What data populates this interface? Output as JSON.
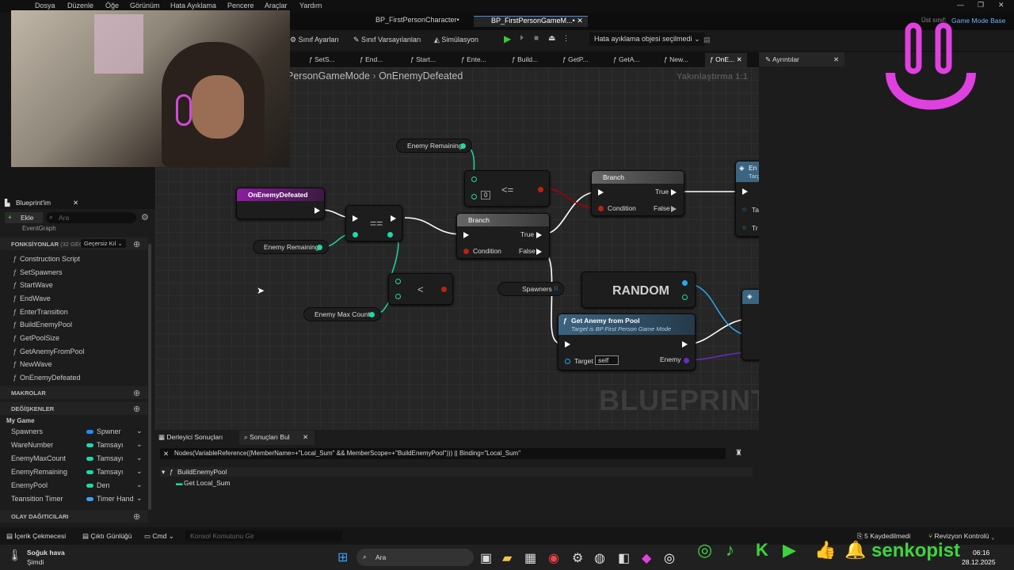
{
  "menu": {
    "items": [
      "Dosya",
      "Düzenle",
      "Öğe",
      "Görünüm",
      "Hata Ayıklama",
      "Pencere",
      "Araçlar",
      "Yardım"
    ]
  },
  "doc_tabs": {
    "tab1": "BP_FirstPersonCharacter•",
    "tab2": "BP_FirstPersonGameM...•",
    "parent_label": "Üst sınıf:",
    "parent_value": "Game Mode Base"
  },
  "toolbar": {
    "class_settings": "Sınıf Ayarları",
    "class_defaults": "Sınıf Varsayılanları",
    "simulation": "Simülasyon",
    "debug_select": "Hata ayıklama objesi seçilmedi"
  },
  "func_tabs": [
    "SetS...",
    "End...",
    "Start...",
    "Ente...",
    "Build...",
    "GetP...",
    "GetA...",
    "New...",
    "OnE..."
  ],
  "details": {
    "title": "Ayrıntılar"
  },
  "breadcrumb": {
    "path": "PersonGameMode",
    "current": "OnEnemyDefeated",
    "zoom": "Yakınlaştırma 1:1"
  },
  "graph": {
    "event_node": "OnEnemyDefeated",
    "enemy_remaining_1": "Enemy Remaining",
    "enemy_remaining_2": "Enemy Remaining",
    "enemy_max_count": "Enemy Max Count",
    "equals_op": "==",
    "lte_op": "<=",
    "lt_op": "<",
    "lte_value": "0",
    "branch1_title": "Branch",
    "branch1_true": "True",
    "branch1_false": "False",
    "branch1_cond": "Condition",
    "branch2_title": "Branch",
    "branch2_true": "True",
    "branch2_false": "False",
    "branch2_cond": "Condition",
    "spawners": "Spawners",
    "random": "RANDOM",
    "getpool_title": "Get Anemy from Pool",
    "getpool_sub": "Target is BP First Person Game Mode",
    "getpool_target": "Target",
    "getpool_self": "self",
    "getpool_enemy": "Enemy",
    "right_node_title": "En",
    "right_node_sub": "Targ",
    "right_pin1": "Ta",
    "right_pin2": "Tr",
    "watermark": "BLUEPRINT"
  },
  "blueprint_panel": {
    "title": "Blueprint'im",
    "add_label": "Ekle",
    "search_placeholder": "Ara",
    "eventgraph": "EventGraph",
    "functions_label": "FONKSİYONLAR",
    "functions_count": "(32 GEÇ",
    "override_label": "Geçersiz Kıl",
    "functions": [
      "Construction Script",
      "SetSpawners",
      "StartWave",
      "EndWave",
      "EnterTransition",
      "BuildEnemyPool",
      "GetPoolSize",
      "GetAnemyFromPool",
      "NewWave",
      "OnEnemyDefeated"
    ],
    "macros_label": "MAKROLAR",
    "variables_label": "DEĞİŞKENLER",
    "category": "My Game",
    "variables": [
      {
        "name": "Spawners",
        "type": "Spwner",
        "color": "#1e90ff"
      },
      {
        "name": "WareNumber",
        "type": "Tamsayı",
        "color": "#1fd8a8"
      },
      {
        "name": "EnemyMaxCount",
        "type": "Tamsayı",
        "color": "#1fd8a8"
      },
      {
        "name": "EnemyRemaining",
        "type": "Tamsayı",
        "color": "#1fd8a8"
      },
      {
        "name": "EnemyPool",
        "type": "Den",
        "color": "#1fd8a8"
      },
      {
        "name": "Teansition Timer",
        "type": "Timer Hand",
        "color": "#3aa0ff"
      }
    ],
    "dispatchers_label": "OLAY DAĞITICILARI"
  },
  "bottom": {
    "tab_compiler": "Derleyici Sonuçları",
    "tab_find": "Sonuçları Bul",
    "query": "Nodes(VariableReference((MemberName=+\"Local_Sum\" && MemberScope=+\"BuildEnemyPool\"))) || Binding=\"Local_Sum\"",
    "result_func": "BuildEnemyPool",
    "result_item": "Get Local_Sum"
  },
  "status": {
    "content_browser": "İçerik Çekmecesi",
    "output_log": "Çıktı Günlüğü",
    "cmd": "Cmd",
    "console_placeholder": "Konsol Komutunu Gir",
    "saved": "5 Kaydedilmedi",
    "revision": "Revizyon Kontrolü"
  },
  "taskbar": {
    "weather_title": "Soğuk hava",
    "weather_sub": "Şimdi",
    "search": "Ara",
    "time": "06:16",
    "date": "28.12.2025"
  },
  "overlay": {
    "brand": "senkopist"
  }
}
